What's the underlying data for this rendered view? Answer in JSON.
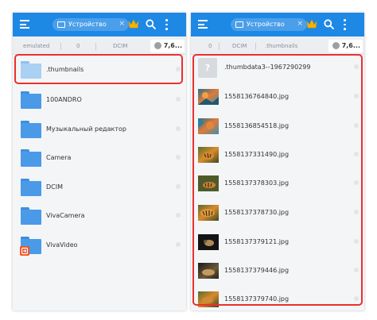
{
  "left": {
    "tab_label": "Устройство",
    "tab_close": "×",
    "breadcrumbs": [
      "emulated",
      "0",
      "DCIM"
    ],
    "storage": "7,6...",
    "items": [
      {
        "label": ".thumbnails",
        "icon": "folder-icon"
      },
      {
        "label": "100ANDRO",
        "icon": "folder-icon"
      },
      {
        "label": "Музыкальный редактор",
        "icon": "folder-icon"
      },
      {
        "label": "Camera",
        "icon": "folder-icon"
      },
      {
        "label": "DCIM",
        "icon": "folder-icon"
      },
      {
        "label": "VivaCamera",
        "icon": "folder-icon"
      },
      {
        "label": "VivaVideo",
        "icon": "folder-icon"
      }
    ]
  },
  "right": {
    "tab_label": "Устройство",
    "tab_close": "×",
    "breadcrumbs": [
      "0",
      "DCIM",
      ".thumbnails"
    ],
    "storage": "7,6...",
    "unknown_glyph": "?",
    "items": [
      {
        "label": ".thumbdata3--1967290299"
      },
      {
        "label": "1558136764840.jpg"
      },
      {
        "label": "1558136854518.jpg"
      },
      {
        "label": "1558137331490.jpg"
      },
      {
        "label": "1558137378303.jpg"
      },
      {
        "label": "1558137378730.jpg"
      },
      {
        "label": "1558137379121.jpg"
      },
      {
        "label": "1558137379446.jpg"
      },
      {
        "label": "1558137379740.jpg"
      }
    ]
  },
  "colors": {
    "toolbar": "#1e88e5",
    "folder": "#4a9ae8",
    "highlight": "#e8312f",
    "crown": "#f5b300"
  }
}
